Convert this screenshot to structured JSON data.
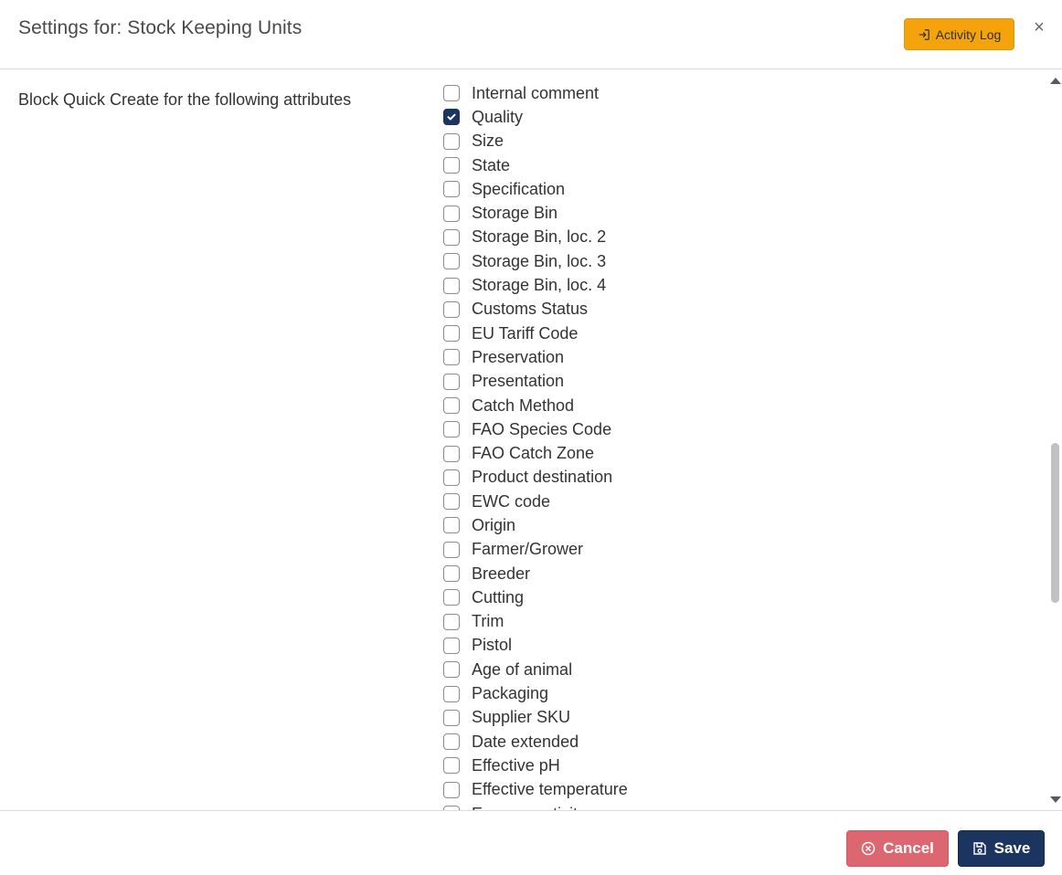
{
  "header": {
    "title": "Settings for: Stock Keeping Units",
    "activity_log_label": "Activity Log",
    "close_glyph": "×"
  },
  "field": {
    "label": "Block Quick Create for the following attributes"
  },
  "attributes": [
    {
      "label": "Internal comment",
      "checked": false
    },
    {
      "label": "Quality",
      "checked": true
    },
    {
      "label": "Size",
      "checked": false
    },
    {
      "label": "State",
      "checked": false
    },
    {
      "label": "Specification",
      "checked": false
    },
    {
      "label": "Storage Bin",
      "checked": false
    },
    {
      "label": "Storage Bin, loc. 2",
      "checked": false
    },
    {
      "label": "Storage Bin, loc. 3",
      "checked": false
    },
    {
      "label": "Storage Bin, loc. 4",
      "checked": false
    },
    {
      "label": "Customs Status",
      "checked": false
    },
    {
      "label": "EU Tariff Code",
      "checked": false
    },
    {
      "label": "Preservation",
      "checked": false
    },
    {
      "label": "Presentation",
      "checked": false
    },
    {
      "label": "Catch Method",
      "checked": false
    },
    {
      "label": "FAO Species Code",
      "checked": false
    },
    {
      "label": "FAO Catch Zone",
      "checked": false
    },
    {
      "label": "Product destination",
      "checked": false
    },
    {
      "label": "EWC code",
      "checked": false
    },
    {
      "label": "Origin",
      "checked": false
    },
    {
      "label": "Farmer/Grower",
      "checked": false
    },
    {
      "label": "Breeder",
      "checked": false
    },
    {
      "label": "Cutting",
      "checked": false
    },
    {
      "label": "Trim",
      "checked": false
    },
    {
      "label": "Pistol",
      "checked": false
    },
    {
      "label": "Age of animal",
      "checked": false
    },
    {
      "label": "Packaging",
      "checked": false
    },
    {
      "label": "Supplier SKU",
      "checked": false
    },
    {
      "label": "Date extended",
      "checked": false
    },
    {
      "label": "Effective pH",
      "checked": false
    },
    {
      "label": "Effective temperature",
      "checked": false
    },
    {
      "label": "Enzyme activity",
      "checked": false
    }
  ],
  "footer": {
    "cancel_label": "Cancel",
    "save_label": "Save"
  },
  "colors": {
    "activity_log_bg": "#f5a30c",
    "cancel_bg": "#dc6770",
    "save_bg": "#1c3560",
    "checkbox_checked": "#1c3560"
  }
}
